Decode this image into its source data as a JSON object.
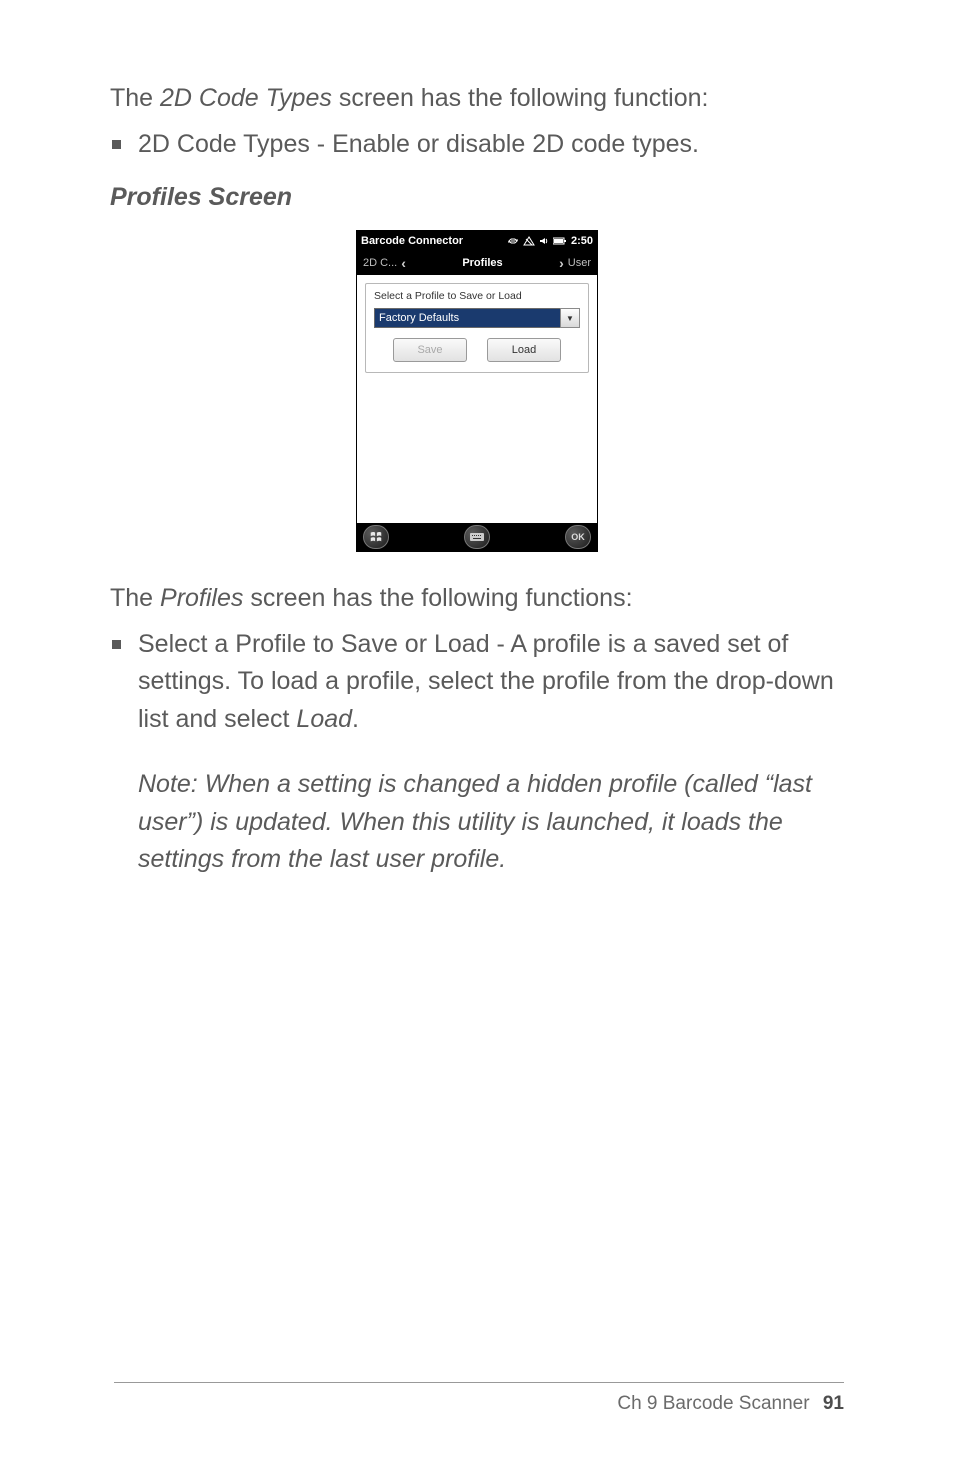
{
  "intro": {
    "line1_before": "The ",
    "line1_italic": "2D Code Types",
    "line1_after": " screen has the following function:",
    "bullet1": "2D Code Types - Enable or disable 2D code types."
  },
  "section_title": "Profiles Screen",
  "device": {
    "title": "Barcode Connector",
    "clock": "2:50",
    "tab_left": "2D C...",
    "tab_center": "Profiles",
    "tab_right": "User",
    "panel_label": "Select a Profile to Save or Load",
    "combo_value": "Factory Defaults",
    "btn_save": "Save",
    "btn_load": "Load",
    "ok": "OK"
  },
  "after": {
    "line_before": "The ",
    "line_italic": "Profiles",
    "line_after": " screen has the following functions:",
    "bullet_main_before": "Select a Profile to Save or Load - A profile is a saved set of settings. To load a profile, select the profile from the drop-down list and select ",
    "bullet_main_italic": "Load",
    "bullet_main_after": ".",
    "note": "Note: When a setting is changed a hidden profile (called “last user”) is updated. When this utility is launched, it loads the settings from the last user profile."
  },
  "footer": {
    "chapter": "Ch 9   Barcode Scanner",
    "page": "91"
  }
}
